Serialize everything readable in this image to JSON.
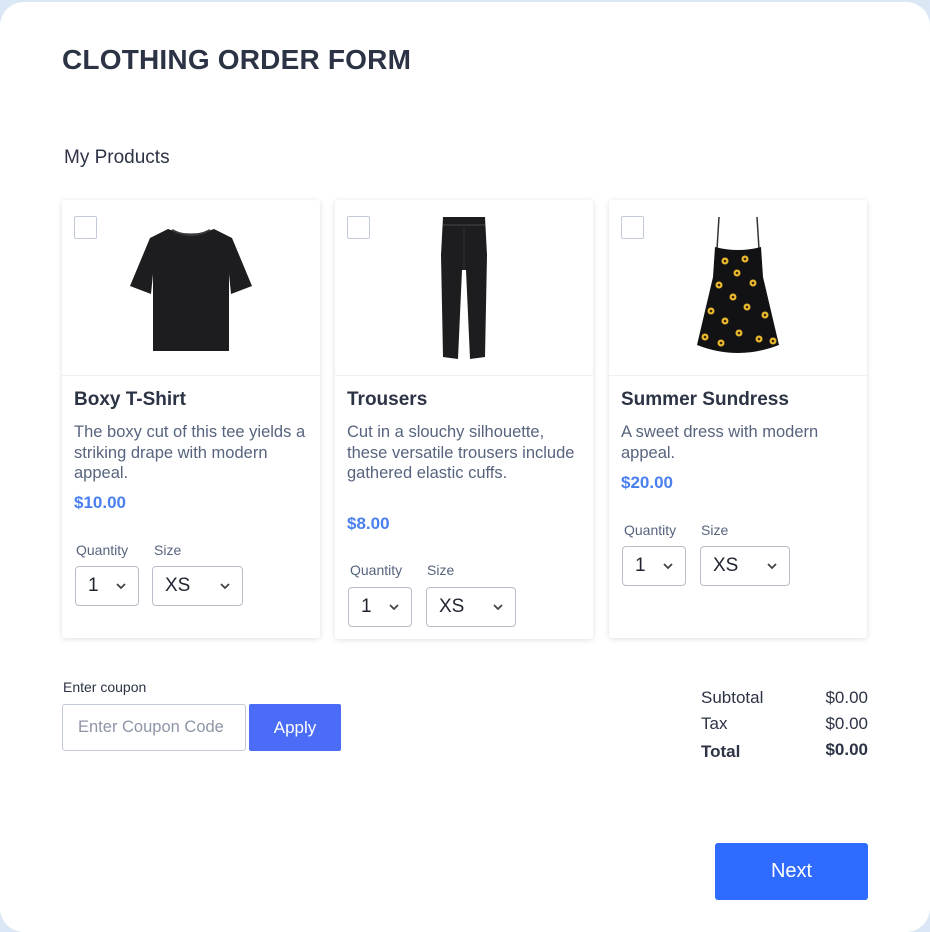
{
  "form": {
    "title": "CLOTHING ORDER FORM",
    "section_label": "My Products"
  },
  "products": [
    {
      "name": "Boxy T-Shirt",
      "description": "The boxy cut of this tee yields a striking drape with modern appeal.",
      "price": "$10.00",
      "quantity_label": "Quantity",
      "quantity_value": "1",
      "size_label": "Size",
      "size_value": "XS",
      "checked": false,
      "image_icon": "tshirt-image"
    },
    {
      "name": "Trousers",
      "description": "Cut in a slouchy silhouette, these versatile trousers include gathered elastic cuffs.",
      "price": "$8.00",
      "quantity_label": "Quantity",
      "quantity_value": "1",
      "size_label": "Size",
      "size_value": "XS",
      "checked": false,
      "image_icon": "trousers-image"
    },
    {
      "name": "Summer Sundress",
      "description": "A sweet dress with modern appeal.",
      "price": "$20.00",
      "quantity_label": "Quantity",
      "quantity_value": "1",
      "size_label": "Size",
      "size_value": "XS",
      "checked": false,
      "image_icon": "sundress-image"
    }
  ],
  "coupon": {
    "label": "Enter coupon",
    "placeholder": "Enter Coupon Code",
    "value": "",
    "apply_label": "Apply"
  },
  "totals": {
    "subtotal_label": "Subtotal",
    "subtotal_value": "$0.00",
    "tax_label": "Tax",
    "tax_value": "$0.00",
    "total_label": "Total",
    "total_value": "$0.00"
  },
  "next_label": "Next",
  "colors": {
    "page_background": "#dbe7f5",
    "price": "#4a7ff0",
    "apply_button": "#4a6cf7",
    "next_button": "#2f6bff",
    "heading": "#2c3345"
  }
}
